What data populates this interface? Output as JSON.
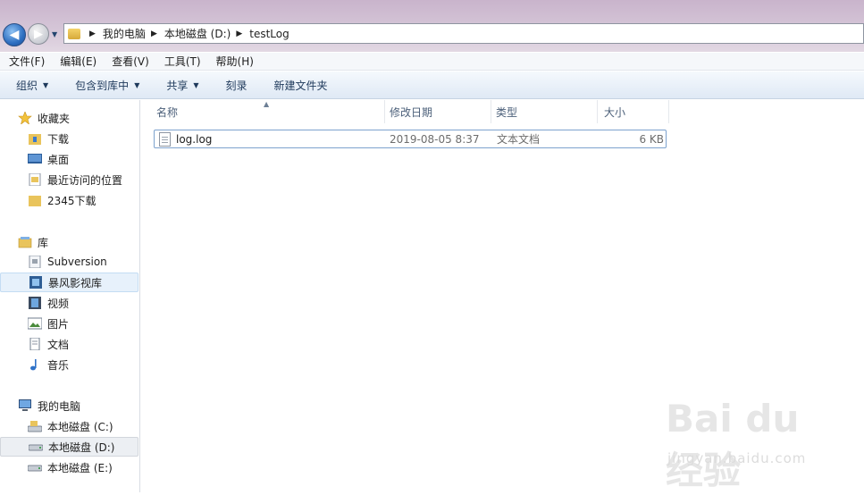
{
  "address": {
    "crumbs": [
      "我的电脑",
      "本地磁盘 (D:)",
      "testLog"
    ]
  },
  "menu": [
    "文件(F)",
    "编辑(E)",
    "查看(V)",
    "工具(T)",
    "帮助(H)"
  ],
  "toolbar": [
    {
      "label": "组织",
      "dropdown": true
    },
    {
      "label": "包含到库中",
      "dropdown": true
    },
    {
      "label": "共享",
      "dropdown": true
    },
    {
      "label": "刻录",
      "dropdown": false
    },
    {
      "label": "新建文件夹",
      "dropdown": false
    }
  ],
  "sidebar": {
    "favorites": {
      "label": "收藏夹",
      "items": [
        "下载",
        "桌面",
        "最近访问的位置",
        "2345下载"
      ]
    },
    "libraries": {
      "label": "库",
      "items": [
        "Subversion",
        "暴风影视库",
        "视频",
        "图片",
        "文档",
        "音乐"
      ]
    },
    "computer": {
      "label": "我的电脑",
      "items": [
        "本地磁盘 (C:)",
        "本地磁盘 (D:)",
        "本地磁盘 (E:)"
      ]
    }
  },
  "columns": {
    "name": "名称",
    "modified": "修改日期",
    "type": "类型",
    "size": "大小"
  },
  "files": [
    {
      "name": "log.log",
      "modified": "2019-08-05 8:37",
      "type": "文本文档",
      "size": "6 KB"
    }
  ],
  "watermark": {
    "main": "Bai du 经验",
    "sub": "jingyan.baidu.com"
  },
  "colors": {
    "accent": "#2e6fc1",
    "toolbar_text": "#1e395b",
    "column_header_text": "#4c607a"
  }
}
